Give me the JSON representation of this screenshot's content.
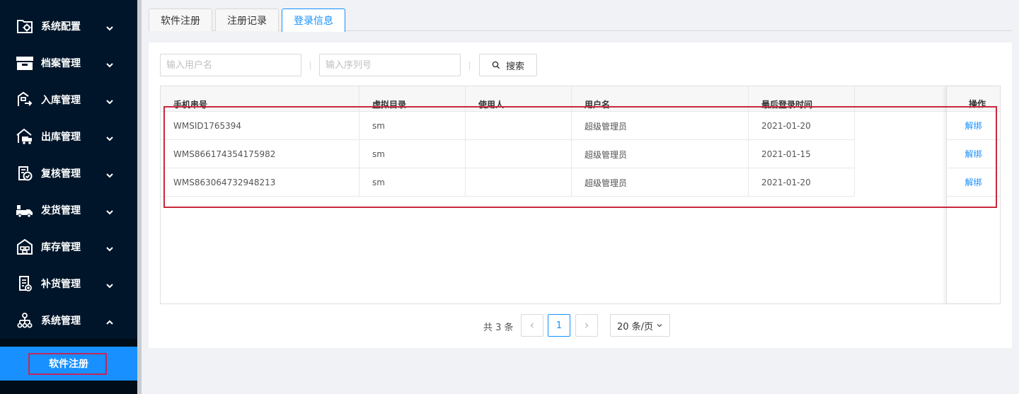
{
  "sidebar": {
    "items": [
      {
        "label": "系统配置",
        "icon": "gear-folder-icon",
        "expanded": false
      },
      {
        "label": "档案管理",
        "icon": "archive-box-icon",
        "expanded": false
      },
      {
        "label": "入库管理",
        "icon": "inbound-icon",
        "expanded": false
      },
      {
        "label": "出库管理",
        "icon": "outbound-truck-icon",
        "expanded": false
      },
      {
        "label": "复核管理",
        "icon": "review-check-icon",
        "expanded": false
      },
      {
        "label": "发货管理",
        "icon": "delivery-truck-icon",
        "expanded": false
      },
      {
        "label": "库存管理",
        "icon": "warehouse-icon",
        "expanded": false
      },
      {
        "label": "补货管理",
        "icon": "replenish-doc-icon",
        "expanded": false
      },
      {
        "label": "系统管理",
        "icon": "org-chart-icon",
        "expanded": true
      }
    ],
    "submenu_active": "软件注册"
  },
  "tabs": [
    {
      "label": "软件注册",
      "active": false
    },
    {
      "label": "注册记录",
      "active": false
    },
    {
      "label": "登录信息",
      "active": true
    }
  ],
  "filters": {
    "username_placeholder": "输入用户名",
    "serial_placeholder": "输入序列号",
    "search_label": "搜索"
  },
  "table": {
    "columns": [
      "手机串号",
      "虚拟目录",
      "使用人",
      "用户名",
      "最后登录时间"
    ],
    "op_column": "操作",
    "rows": [
      {
        "serial": "WMSID1765394",
        "dir": "sm",
        "user": "",
        "username": "超级管理员",
        "last_login": "2021-01-20",
        "op": "解绑"
      },
      {
        "serial": "WMS866174354175982",
        "dir": "sm",
        "user": "",
        "username": "超级管理员",
        "last_login": "2021-01-15",
        "op": "解绑"
      },
      {
        "serial": "WMS863064732948213",
        "dir": "sm",
        "user": "",
        "username": "超级管理员",
        "last_login": "2021-01-20",
        "op": "解绑"
      }
    ]
  },
  "pagination": {
    "total_text": "共 3 条",
    "current_page": "1",
    "page_size": "20 条/页"
  },
  "colors": {
    "sidebar_bg": "#001529",
    "accent": "#1890ff",
    "highlight_red": "#c8283c"
  }
}
